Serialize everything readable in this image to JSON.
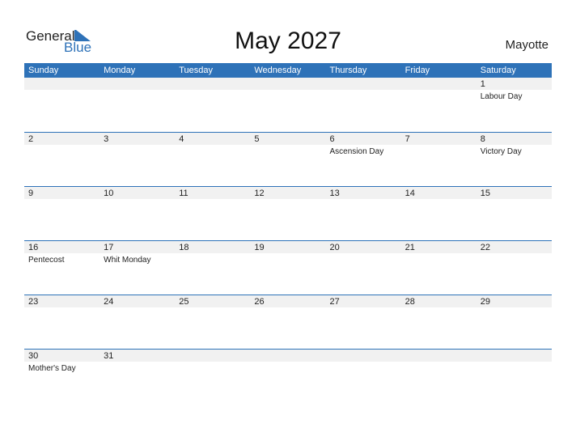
{
  "logo": {
    "general": "General",
    "blue": "Blue"
  },
  "title": "May 2027",
  "country": "Mayotte",
  "weekdays": [
    "Sunday",
    "Monday",
    "Tuesday",
    "Wednesday",
    "Thursday",
    "Friday",
    "Saturday"
  ],
  "weeks": [
    [
      {
        "d": ""
      },
      {
        "d": ""
      },
      {
        "d": ""
      },
      {
        "d": ""
      },
      {
        "d": ""
      },
      {
        "d": ""
      },
      {
        "d": "1",
        "h": "Labour Day"
      }
    ],
    [
      {
        "d": "2"
      },
      {
        "d": "3"
      },
      {
        "d": "4"
      },
      {
        "d": "5"
      },
      {
        "d": "6",
        "h": "Ascension Day"
      },
      {
        "d": "7"
      },
      {
        "d": "8",
        "h": "Victory Day"
      }
    ],
    [
      {
        "d": "9"
      },
      {
        "d": "10"
      },
      {
        "d": "11"
      },
      {
        "d": "12"
      },
      {
        "d": "13"
      },
      {
        "d": "14"
      },
      {
        "d": "15"
      }
    ],
    [
      {
        "d": "16",
        "h": "Pentecost"
      },
      {
        "d": "17",
        "h": "Whit Monday"
      },
      {
        "d": "18"
      },
      {
        "d": "19"
      },
      {
        "d": "20"
      },
      {
        "d": "21"
      },
      {
        "d": "22"
      }
    ],
    [
      {
        "d": "23"
      },
      {
        "d": "24"
      },
      {
        "d": "25"
      },
      {
        "d": "26"
      },
      {
        "d": "27"
      },
      {
        "d": "28"
      },
      {
        "d": "29"
      }
    ],
    [
      {
        "d": "30",
        "h": "Mother's Day"
      },
      {
        "d": "31"
      },
      {
        "d": ""
      },
      {
        "d": ""
      },
      {
        "d": ""
      },
      {
        "d": ""
      },
      {
        "d": ""
      }
    ]
  ],
  "colors": {
    "accent": "#2e72b8",
    "strip": "#f1f1f1"
  }
}
